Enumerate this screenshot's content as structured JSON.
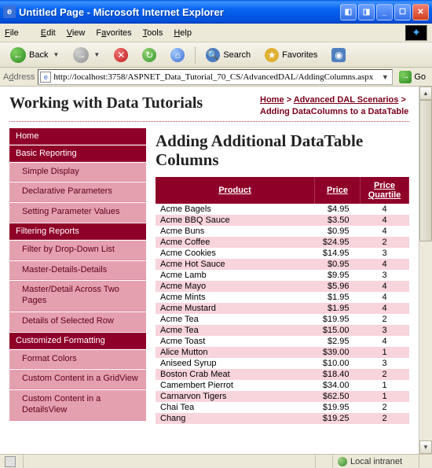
{
  "window": {
    "title": "Untitled Page - Microsoft Internet Explorer"
  },
  "menu": {
    "file": "File",
    "edit": "Edit",
    "view": "View",
    "favorites": "Favorites",
    "tools": "Tools",
    "help": "Help"
  },
  "toolbar": {
    "back": "Back",
    "search": "Search",
    "favorites": "Favorites"
  },
  "address": {
    "label": "Address",
    "url": "http://localhost:3758/ASPNET_Data_Tutorial_70_CS/AdvancedDAL/AddingColumns.aspx",
    "go": "Go"
  },
  "page": {
    "siteTitle": "Working with Data Tutorials",
    "breadcrumb": {
      "home": "Home",
      "l1": "Advanced DAL Scenarios",
      "current": "Adding DataColumns to a DataTable"
    },
    "heading": "Adding Additional DataTable Columns",
    "sidebar": [
      {
        "type": "cat",
        "label": "Home"
      },
      {
        "type": "cat",
        "label": "Basic Reporting"
      },
      {
        "type": "sub",
        "label": "Simple Display"
      },
      {
        "type": "sub",
        "label": "Declarative Parameters"
      },
      {
        "type": "sub",
        "label": "Setting Parameter Values"
      },
      {
        "type": "cat",
        "label": "Filtering Reports"
      },
      {
        "type": "sub",
        "label": "Filter by Drop-Down List"
      },
      {
        "type": "sub",
        "label": "Master-Details-Details"
      },
      {
        "type": "sub",
        "label": "Master/Detail Across Two Pages"
      },
      {
        "type": "sub",
        "label": "Details of Selected Row"
      },
      {
        "type": "cat",
        "label": "Customized Formatting"
      },
      {
        "type": "sub",
        "label": "Format Colors"
      },
      {
        "type": "sub",
        "label": "Custom Content in a GridView"
      },
      {
        "type": "sub",
        "label": "Custom Content in a DetailsView"
      }
    ],
    "table": {
      "headers": {
        "product": "Product",
        "price": "Price",
        "quartile": "Price Quartile"
      },
      "rows": [
        {
          "product": "Acme Bagels",
          "price": "$4.95",
          "q": "4"
        },
        {
          "product": "Acme BBQ Sauce",
          "price": "$3.50",
          "q": "4"
        },
        {
          "product": "Acme Buns",
          "price": "$0.95",
          "q": "4"
        },
        {
          "product": "Acme Coffee",
          "price": "$24.95",
          "q": "2"
        },
        {
          "product": "Acme Cookies",
          "price": "$14.95",
          "q": "3"
        },
        {
          "product": "Acme Hot Sauce",
          "price": "$0.95",
          "q": "4"
        },
        {
          "product": "Acme Lamb",
          "price": "$9.95",
          "q": "3"
        },
        {
          "product": "Acme Mayo",
          "price": "$5.96",
          "q": "4"
        },
        {
          "product": "Acme Mints",
          "price": "$1.95",
          "q": "4"
        },
        {
          "product": "Acme Mustard",
          "price": "$1.95",
          "q": "4"
        },
        {
          "product": "Acme Tea",
          "price": "$19.95",
          "q": "2"
        },
        {
          "product": "Acme Tea",
          "price": "$15.00",
          "q": "3"
        },
        {
          "product": "Acme Toast",
          "price": "$2.95",
          "q": "4"
        },
        {
          "product": "Alice Mutton",
          "price": "$39.00",
          "q": "1"
        },
        {
          "product": "Aniseed Syrup",
          "price": "$10.00",
          "q": "3"
        },
        {
          "product": "Boston Crab Meat",
          "price": "$18.40",
          "q": "2"
        },
        {
          "product": "Camembert Pierrot",
          "price": "$34.00",
          "q": "1"
        },
        {
          "product": "Carnarvon Tigers",
          "price": "$62.50",
          "q": "1"
        },
        {
          "product": "Chai Tea",
          "price": "$19.95",
          "q": "2"
        },
        {
          "product": "Chang",
          "price": "$19.25",
          "q": "2"
        }
      ]
    }
  },
  "status": {
    "zone": "Local intranet"
  }
}
